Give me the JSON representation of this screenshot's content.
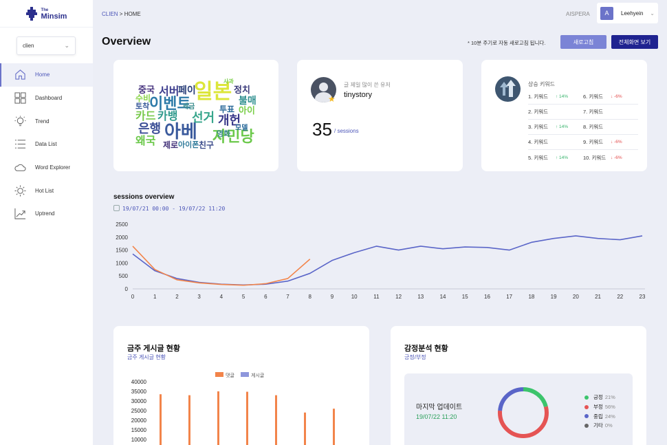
{
  "brand": {
    "the": "The",
    "name": "Minsim"
  },
  "site_select": {
    "value": "clien"
  },
  "nav": [
    {
      "label": "Home",
      "icon": "home-icon"
    },
    {
      "label": "Dashboard",
      "icon": "dashboard-icon"
    },
    {
      "label": "Trend",
      "icon": "bulb-icon"
    },
    {
      "label": "Data List",
      "icon": "list-icon"
    },
    {
      "label": "Word Explorer",
      "icon": "cloud-icon"
    },
    {
      "label": "Hot List",
      "icon": "sun-icon"
    },
    {
      "label": "Uptrend",
      "icon": "uptrend-icon"
    }
  ],
  "breadcrumb": {
    "root": "CLIEN",
    "sep": " > ",
    "current": "HOME"
  },
  "header": {
    "org": "AISPERA",
    "avatar_letter": "A",
    "user": "Leehyein"
  },
  "page": {
    "title": "Overview",
    "refresh_note": "* 10분 주기로 자동 새로고침 됩니다.",
    "refresh_button": "새로고침",
    "fullscreen_button": "전체화면 보기"
  },
  "top_user": {
    "label": "글 제일 많이 쓴 유저",
    "name": "tinystory",
    "sessions": "35",
    "sessions_unit": "/ sessions"
  },
  "keywords": {
    "title": "상승 키워드",
    "rows": [
      {
        "left": {
          "name": "1. 키워드",
          "trend": "↑ 14%",
          "dir": "up"
        },
        "right": {
          "name": "6. 키워드",
          "trend": "↓ -6%",
          "dir": "down"
        }
      },
      {
        "left": {
          "name": "2. 키워드",
          "trend": "",
          "dir": ""
        },
        "right": {
          "name": "7. 키워드",
          "trend": "",
          "dir": ""
        }
      },
      {
        "left": {
          "name": "3. 키워드",
          "trend": "↑ 14%",
          "dir": "up"
        },
        "right": {
          "name": "8. 키워드",
          "trend": "",
          "dir": ""
        }
      },
      {
        "left": {
          "name": "4. 키워드",
          "trend": "",
          "dir": ""
        },
        "right": {
          "name": "9. 키워드",
          "trend": "↓ -6%",
          "dir": "down"
        }
      },
      {
        "left": {
          "name": "5. 키워드",
          "trend": "↑ 14%",
          "dir": "up"
        },
        "right": {
          "name": "10. 키워드",
          "trend": "↓ -6%",
          "dir": "down"
        }
      }
    ]
  },
  "wordcloud": {
    "words": [
      {
        "text": "일본",
        "color": "#dce63a"
      },
      {
        "text": "이벤트",
        "color": "#2d7aa8"
      },
      {
        "text": "아베",
        "color": "#3a5a9c"
      },
      {
        "text": "자민당",
        "color": "#6cc94b"
      },
      {
        "text": "서버",
        "color": "#3f3f8f"
      },
      {
        "text": "페이",
        "color": "#2a3f7a"
      },
      {
        "text": "선거",
        "color": "#36a58b"
      },
      {
        "text": "개헌",
        "color": "#3a3a8a"
      },
      {
        "text": "카드",
        "color": "#78c94b"
      },
      {
        "text": "카뱅",
        "color": "#2f9a8c"
      },
      {
        "text": "은행",
        "color": "#3b4e96"
      },
      {
        "text": "중국",
        "color": "#46337e"
      },
      {
        "text": "정치",
        "color": "#3a3a7a"
      },
      {
        "text": "불매",
        "color": "#2f8f8f"
      },
      {
        "text": "아이",
        "color": "#7ccf4a"
      },
      {
        "text": "투표",
        "color": "#2b6a9a"
      },
      {
        "text": "왜국",
        "color": "#6cc94b"
      },
      {
        "text": "토착",
        "color": "#3a5a9a"
      },
      {
        "text": "영화",
        "color": "#3a8a8a"
      },
      {
        "text": "제로",
        "color": "#44337a"
      },
      {
        "text": "아이폰",
        "color": "#2f7a9a"
      },
      {
        "text": "친구",
        "color": "#3a4a8a"
      },
      {
        "text": "수비",
        "color": "#8bd44a"
      },
      {
        "text": "모델",
        "color": "#2a6a9a"
      },
      {
        "text": "세금",
        "color": "#3f8f8f"
      },
      {
        "text": "사과",
        "color": "#7ccf4a"
      }
    ]
  },
  "sessions": {
    "title": "sessions overview",
    "range": "19/07/21 00:00 - 19/07/22 11:20"
  },
  "weekly_posts": {
    "title": "금주 게시글 현황",
    "subtitle": "금주 게시글 현황",
    "legend": [
      "댓글",
      "게시글"
    ]
  },
  "sentiment": {
    "title": "감정분석 현황",
    "subtitle": "긍정/부정",
    "last_update_label": "마지막 업데이트",
    "last_update_date": "19/07/22 11:20",
    "items": [
      {
        "label": "긍정",
        "value": "21%",
        "color": "#3cc46c"
      },
      {
        "label": "부정",
        "value": "56%",
        "color": "#e55454"
      },
      {
        "label": "중립",
        "value": "24%",
        "color": "#5a65c8"
      },
      {
        "label": "기타",
        "value": "0%",
        "color": "#666666"
      }
    ]
  },
  "chart_data": [
    {
      "type": "line",
      "title": "sessions overview",
      "x": [
        0,
        1,
        2,
        3,
        4,
        5,
        6,
        7,
        8,
        9,
        10,
        11,
        12,
        13,
        14,
        15,
        16,
        17,
        18,
        19,
        20,
        21,
        22,
        23
      ],
      "ylim": [
        0,
        2500
      ],
      "yticks": [
        0,
        500,
        1000,
        1500,
        2000,
        2500
      ],
      "series": [
        {
          "color": "#5a65c8",
          "values": [
            1350,
            700,
            400,
            250,
            180,
            150,
            180,
            300,
            600,
            1100,
            1400,
            1650,
            1500,
            1650,
            1550,
            1620,
            1600,
            1500,
            1800,
            1950,
            2050,
            1950,
            1900,
            2050
          ]
        },
        {
          "color": "#f2844a",
          "values": [
            1650,
            750,
            350,
            230,
            170,
            140,
            200,
            400,
            1150
          ]
        }
      ]
    },
    {
      "type": "bar",
      "title": "금주 게시글 현황",
      "yticks": [
        10000,
        15000,
        20000,
        25000,
        30000,
        35000,
        40000
      ],
      "series": [
        {
          "name": "댓글",
          "color": "#f2844a",
          "values": [
            33500,
            33000,
            35000,
            34800,
            33000,
            24000,
            26000
          ]
        },
        {
          "name": "게시글",
          "color": "#8e97dc",
          "values": []
        }
      ]
    },
    {
      "type": "pie",
      "title": "감정분석 현황",
      "categories": [
        "긍정",
        "부정",
        "중립",
        "기타"
      ],
      "values": [
        21,
        56,
        24,
        0
      ]
    }
  ]
}
